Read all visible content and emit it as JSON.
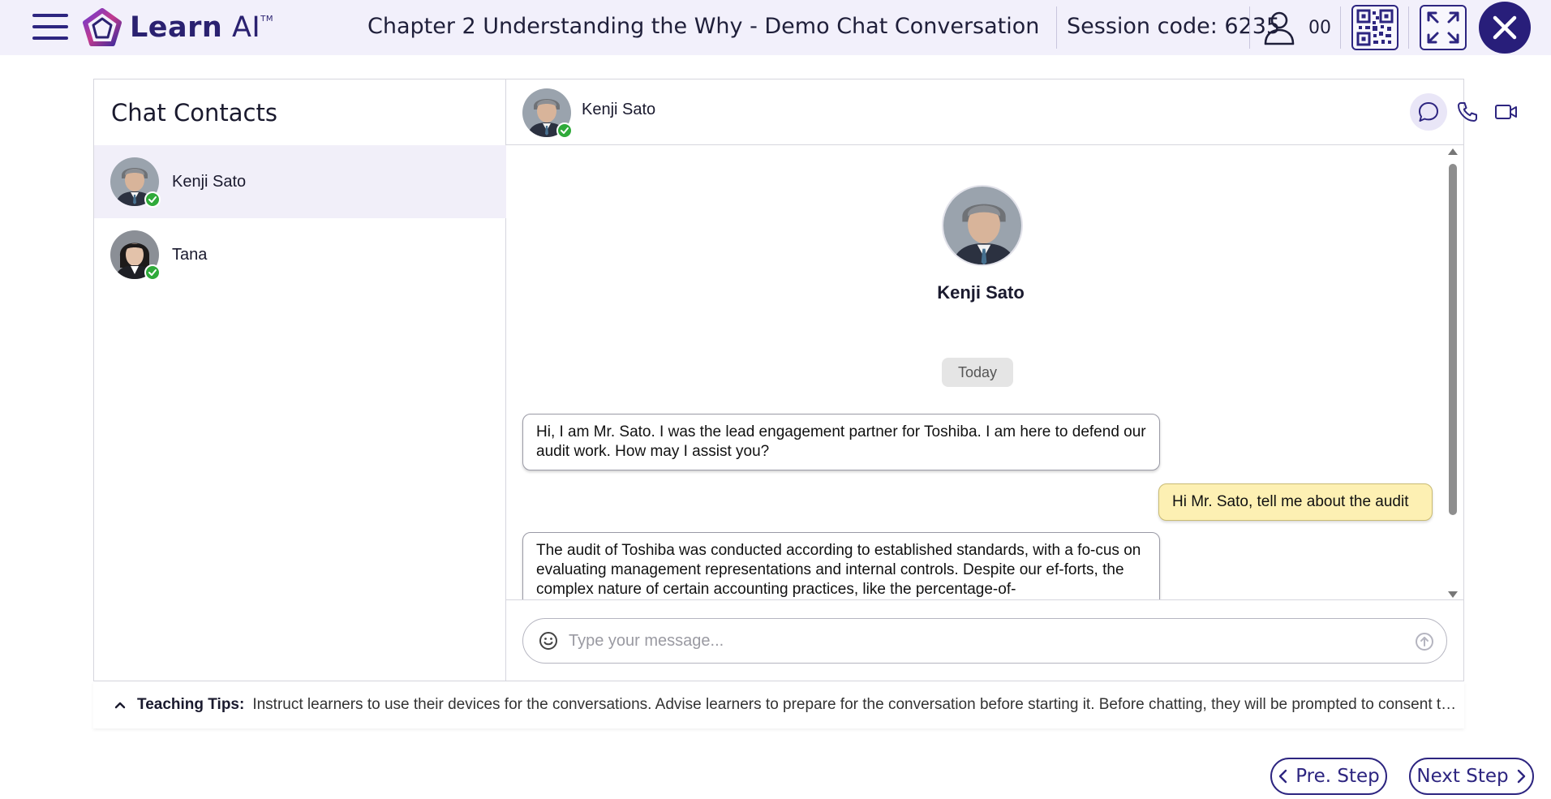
{
  "header": {
    "logo_text_bold": "Learn",
    "logo_text_light": "AI",
    "logo_tm": "TM",
    "title": "Chapter 2 Understanding the Why - Demo Chat Conversation",
    "session_label": "Session code: 6235",
    "user_count": "00",
    "accent_color": "#2d2580"
  },
  "contacts": {
    "title": "Chat Contacts",
    "items": [
      {
        "name": "Kenji Sato",
        "status": "online",
        "active": true
      },
      {
        "name": "Tana",
        "status": "online",
        "active": false
      }
    ]
  },
  "chat": {
    "contact_name": "Kenji Sato",
    "profile_name": "Kenji Sato",
    "date_separator": "Today",
    "messages": [
      {
        "direction": "in",
        "text": "Hi, I am Mr. Sato. I was the lead engagement partner for Toshiba. I am here to defend our audit work. How may I assist you?"
      },
      {
        "direction": "out",
        "text": "Hi Mr. Sato, tell me about the audit"
      },
      {
        "direction": "in",
        "text": "The audit of Toshiba was conducted according to established standards, with a fo-cus on evaluating management representations and internal controls. Despite our ef-forts, the complex nature of certain accounting practices, like the percentage-of-"
      }
    ],
    "composer_placeholder": "Type your message...",
    "header_icons": [
      "chat-icon",
      "phone-icon",
      "video-icon"
    ]
  },
  "tips": {
    "label": "Teaching Tips:",
    "text": "Instruct learners to use their devices for the conversations. Advise learners to prepare for the conversation before starting it. Before chatting, they will be prompted to consent to ..."
  },
  "nav": {
    "prev_label": "Pre. Step",
    "next_label": "Next Step"
  },
  "colors": {
    "topbar_bg": "#f2f0fb",
    "online": "#2faa3a",
    "outgoing_bubble": "#fdf0b3",
    "close_button": "#281e7a"
  }
}
